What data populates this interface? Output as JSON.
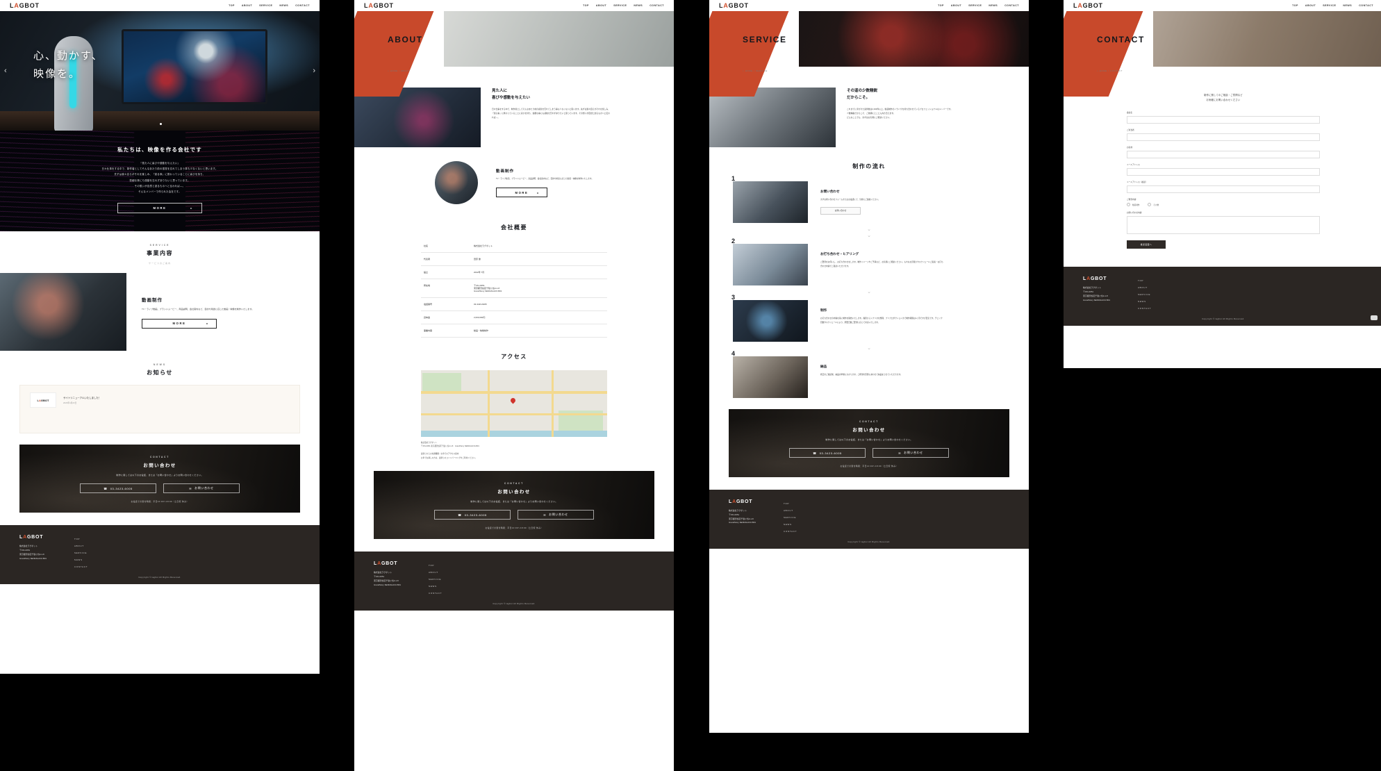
{
  "brand": {
    "name_pre": "L",
    "name_accent": "A",
    "name_post": "GBOT"
  },
  "nav": [
    "TOP",
    "ABOUT",
    "SERVICE",
    "NEWS",
    "CONTACT"
  ],
  "colors": {
    "accent": "#d1502e",
    "dark": "#2b2623",
    "hero_dark": "#05050a"
  },
  "home": {
    "hero": {
      "line1": "心、動かす、",
      "line2": "映像を。",
      "prev": "‹",
      "next": "›"
    },
    "intro": {
      "heading": "私たちは、映像を作る会社です",
      "lines": [
        "『見た人に喜びや感動を与えたい』",
        "日々仕事をする中で、制作者としてそんなあたり前の感覚を忘れてしまう事も少なくないと思います。",
        "先ずは我々自らがそれを楽しみ、「創る事」に携わっていることに喜びを持ち、",
        "些細な事にも感動を忘れずありたいと思っています。",
        "その想いが自然と創るものへと伝われば―。",
        "そんなメンバーで作られた会社です。"
      ],
      "button": "MORE",
      "button_arrow": "▸"
    },
    "service": {
      "en": "SERVICE",
      "jp": "事業内容",
      "sub": "サービスのご案内"
    },
    "service_item": {
      "title": "動画制作",
      "body": "TV・ライブ動画、ブランドムービー、商品説明、会社案内など、目的や用途に応じた動画・映像を制作いたします。",
      "button": "MORE",
      "button_arrow": "▸"
    },
    "news": {
      "en": "NEWS",
      "jp": "お知らせ",
      "items": [
        {
          "title": "サイトリニューアルいたしました！",
          "date": "2023年4月23日"
        }
      ]
    },
    "contact": {
      "en": "CONTACT",
      "jp": "お問い合わせ",
      "note": "制作に関しては以下のお電話、または「お問い合わせ」よりお問い合わせください。",
      "tel": "03-3423-6005",
      "tel_icon": "☎",
      "mail": "お問い合わせ",
      "mail_icon": "✉",
      "hours": "お電話での受付時間：平日10:00〜18:00（土日祝 休み）"
    }
  },
  "about": {
    "title": "ABOUT",
    "crumb": "⌂ HOME / ABOUT",
    "block1": {
      "h1": "見た人に",
      "h2": "喜びや感動を与えたい",
      "body": "日々仕事をする中で、制作者としてそんなあたり前の感覚を忘れてしまう事も少なくないと思います。先ずは我々自らがそれを楽しみ、「創る事」に携わっていることに喜びを持ち、些細な事にも感動を忘れずありたいと思っています。その想いが自然と創るものへと伝われば―。"
    },
    "block2": {
      "title": "動画制作",
      "body": "TV・ライブ動画、ブランドムービー、商品説明、会社案内など、目的や用途に応じた動画・映像を制作いたします。",
      "button": "MORE",
      "button_arrow": "▸"
    },
    "overview_title": "会社概要",
    "overview": [
      {
        "k": "社名",
        "v": "株式会社ラグボット"
      },
      {
        "k": "代表者",
        "v": "田原 優"
      },
      {
        "k": "設立",
        "v": "2022年 7月"
      },
      {
        "k": "所在地",
        "v": "〒151-0051\n東京都渋谷区千駄ヶ谷4-1-8\nGrandStory SENDAGAYA B01"
      },
      {
        "k": "電話番号",
        "v": "03-3423-6005"
      },
      {
        "k": "資本金",
        "v": "2,000,000円"
      },
      {
        "k": "事業内容",
        "v": "動画・映像制作"
      }
    ],
    "access_title": "アクセス",
    "access_note": "株式会社ラグボット\n〒151-0051 東京都渋谷区千駄ヶ谷4-1-8　GrandStory SENDAGAYA B01\n\n最寄りからの交通機関／お車でのアクセス案内\nお車でお越しの方は、最寄りのコインパーキングをご利用ください。"
  },
  "service": {
    "title": "SERVICE",
    "crumb": "⌂ HOME / SERVICE",
    "lead": {
      "h1": "その道の少数精鋭",
      "h2": "だからこそ。",
      "body": "これまでに手がけた案件数は2,000件以上。動画制作のノウハウを持ち合わせているプロフェッショナルなメンバーです。\n少数精鋭だからこそ、ご依頼にとことん向き合えます。\nどんなことでも、まずはお気軽にご相談ください。"
    },
    "flow_title": "制作の流れ",
    "steps": [
      {
        "no": "1",
        "title": "お問い合わせ",
        "body": "まずお問い合わせフォームまたはお電話にて、気軽にご連絡ください。",
        "button": "お問い合わせ"
      },
      {
        "no": "2",
        "title": "お打ち合わせ・ヒアリング",
        "body": "ご要望をお伺いし、お打ち合わせをします。制作イメージやご予算など、お気軽にご相談ください。もれなお見積りやスケジュールご提案・お打ち合わせ内容でご検討いただけます。",
        "button": ""
      },
      {
        "no": "3",
        "title": "制作",
        "body": "お打ち合わせの内容を基に制作を開始いたします。撮影からシナリオを整理、プリプロダクションまで制作期間は1ヶ月ですが目安です。チェック回数やスケジュールにより、所要日数ご要望に応じて対応いたします。",
        "button": ""
      },
      {
        "no": "4",
        "title": "納品",
        "body": "修正のご確認後、納品の準備にかかります。ご希望の形態にあわせて納品をさせていただきます。",
        "button": ""
      }
    ],
    "chev": "⌄"
  },
  "contact_page": {
    "title": "CONTACT",
    "crumb": "⌂ HOME / CONTACT",
    "lead": "制作に関してのご相談・ご質問など\nお気軽にお問い合わせください",
    "fields": [
      {
        "label": "会社名",
        "type": "text"
      },
      {
        "label": "ご担当者",
        "type": "text"
      },
      {
        "label": "お名前",
        "type": "text"
      },
      {
        "label": "メールアドレス",
        "type": "text"
      },
      {
        "label": "メールアドレス（確認）",
        "type": "text"
      },
      {
        "label": "ご希望内容",
        "type": "radio",
        "options": [
          "動画制作",
          "その他"
        ]
      },
      {
        "label": "お問い合わせ内容",
        "type": "textarea"
      }
    ],
    "submit": "確認画面へ"
  },
  "footer": {
    "company": "株式会社ラグボット",
    "zip": "〒151-0051",
    "addr1": "東京都渋谷区千駄ヶ谷4-1-8",
    "addr2": "GrandStory SENDAGAYA B01",
    "nav": [
      "TOP",
      "ABOUT",
      "SERVICE",
      "NEWS",
      "CONTACT"
    ],
    "copyright": "Copyright © lagbot All Rights Reserved."
  }
}
